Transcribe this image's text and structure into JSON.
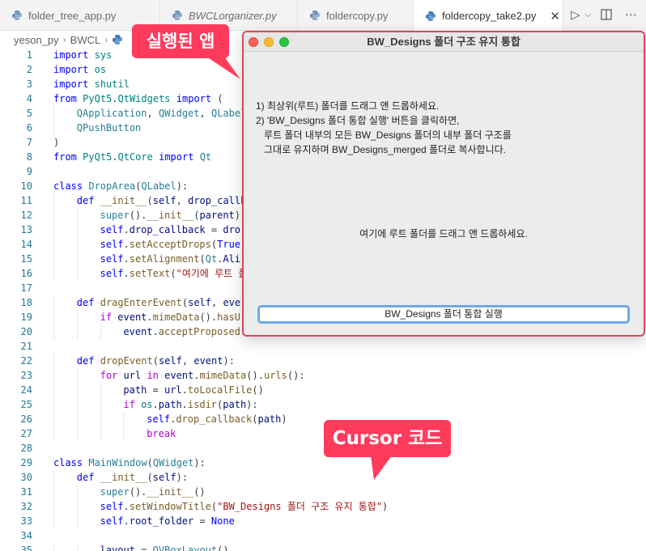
{
  "tabs": [
    {
      "label": "folder_tree_app.py",
      "style": "normal",
      "active": false
    },
    {
      "label": "BWCLorganizer.py",
      "style": "italic",
      "active": false
    },
    {
      "label": "foldercopy.py",
      "style": "normal",
      "active": false
    },
    {
      "label": "foldercopy_take2.py",
      "style": "normal",
      "active": true
    }
  ],
  "tab_close_glyph": "✕",
  "toolbar": {
    "run_icon": "▷",
    "run_menu_icon": "⌵",
    "split_icon": "split-editor-icon",
    "more_icon": "⋯"
  },
  "breadcrumb": {
    "items": [
      "yeson_py",
      "BWCL"
    ],
    "separator": "›"
  },
  "colors": {
    "callout": "#ff3b5c",
    "window_border": "#e0455a",
    "button_focus": "#6ea9e6",
    "line_number": "#237893"
  },
  "code": {
    "lines": [
      {
        "n": "1",
        "indent": 0,
        "tokens": [
          [
            "k",
            "import"
          ],
          [
            "t",
            " "
          ],
          [
            "m",
            "sys"
          ]
        ]
      },
      {
        "n": "2",
        "indent": 0,
        "tokens": [
          [
            "k",
            "import"
          ],
          [
            "t",
            " "
          ],
          [
            "m",
            "os"
          ]
        ]
      },
      {
        "n": "3",
        "indent": 0,
        "tokens": [
          [
            "k",
            "import"
          ],
          [
            "t",
            " "
          ],
          [
            "m",
            "shutil"
          ]
        ]
      },
      {
        "n": "4",
        "indent": 0,
        "tokens": [
          [
            "k",
            "from"
          ],
          [
            "t",
            " "
          ],
          [
            "m",
            "PyQt5"
          ],
          [
            "t",
            "."
          ],
          [
            "m",
            "QtWidgets"
          ],
          [
            "t",
            " "
          ],
          [
            "k",
            "import"
          ],
          [
            "t",
            " ("
          ]
        ]
      },
      {
        "n": "5",
        "indent": 1,
        "tokens": [
          [
            "c",
            "QApplication"
          ],
          [
            "t",
            ", "
          ],
          [
            "c",
            "QWidget"
          ],
          [
            "t",
            ", "
          ],
          [
            "c",
            "QLabel"
          ]
        ]
      },
      {
        "n": "6",
        "indent": 1,
        "tokens": [
          [
            "c",
            "QPushButton"
          ]
        ]
      },
      {
        "n": "7",
        "indent": 0,
        "tokens": [
          [
            "t",
            ")"
          ]
        ]
      },
      {
        "n": "8",
        "indent": 0,
        "tokens": [
          [
            "k",
            "from"
          ],
          [
            "t",
            " "
          ],
          [
            "m",
            "PyQt5"
          ],
          [
            "t",
            "."
          ],
          [
            "m",
            "QtCore"
          ],
          [
            "t",
            " "
          ],
          [
            "k",
            "import"
          ],
          [
            "t",
            " "
          ],
          [
            "c",
            "Qt"
          ]
        ]
      },
      {
        "n": "9",
        "indent": 0,
        "tokens": []
      },
      {
        "n": "10",
        "indent": 0,
        "tokens": [
          [
            "k",
            "class"
          ],
          [
            "t",
            " "
          ],
          [
            "c",
            "DropArea"
          ],
          [
            "t",
            "("
          ],
          [
            "c",
            "QLabel"
          ],
          [
            "t",
            "):"
          ]
        ]
      },
      {
        "n": "11",
        "indent": 1,
        "tokens": [
          [
            "k",
            "def"
          ],
          [
            "t",
            " "
          ],
          [
            "f",
            "__init__"
          ],
          [
            "t",
            "("
          ],
          [
            "v",
            "self"
          ],
          [
            "t",
            ", "
          ],
          [
            "v",
            "drop_callb"
          ]
        ]
      },
      {
        "n": "12",
        "indent": 2,
        "tokens": [
          [
            "c",
            "super"
          ],
          [
            "t",
            "()."
          ],
          [
            "f",
            "__init__"
          ],
          [
            "t",
            "("
          ],
          [
            "v",
            "parent"
          ],
          [
            "t",
            ")"
          ]
        ]
      },
      {
        "n": "13",
        "indent": 2,
        "tokens": [
          [
            "sf",
            "self"
          ],
          [
            "t",
            "."
          ],
          [
            "v",
            "drop_callback"
          ],
          [
            "t",
            " = "
          ],
          [
            "v",
            "dro"
          ]
        ]
      },
      {
        "n": "14",
        "indent": 2,
        "tokens": [
          [
            "sf",
            "self"
          ],
          [
            "t",
            "."
          ],
          [
            "f",
            "setAcceptDrops"
          ],
          [
            "t",
            "("
          ],
          [
            "kc",
            "True"
          ]
        ]
      },
      {
        "n": "15",
        "indent": 2,
        "tokens": [
          [
            "sf",
            "self"
          ],
          [
            "t",
            "."
          ],
          [
            "f",
            "setAlignment"
          ],
          [
            "t",
            "("
          ],
          [
            "c",
            "Qt"
          ],
          [
            "t",
            "."
          ],
          [
            "v",
            "Ali"
          ]
        ]
      },
      {
        "n": "16",
        "indent": 2,
        "tokens": [
          [
            "sf",
            "self"
          ],
          [
            "t",
            "."
          ],
          [
            "f",
            "setText"
          ],
          [
            "t",
            "("
          ],
          [
            "s",
            "\"여기에 루트 폴"
          ]
        ]
      },
      {
        "n": "17",
        "indent": 0,
        "tokens": []
      },
      {
        "n": "18",
        "indent": 1,
        "tokens": [
          [
            "k",
            "def"
          ],
          [
            "t",
            " "
          ],
          [
            "f",
            "dragEnterEvent"
          ],
          [
            "t",
            "("
          ],
          [
            "v",
            "self"
          ],
          [
            "t",
            ", "
          ],
          [
            "v",
            "eve"
          ]
        ]
      },
      {
        "n": "19",
        "indent": 2,
        "tokens": [
          [
            "ctl",
            "if"
          ],
          [
            "t",
            " "
          ],
          [
            "v",
            "event"
          ],
          [
            "t",
            "."
          ],
          [
            "f",
            "mimeData"
          ],
          [
            "t",
            "()."
          ],
          [
            "f",
            "hasU"
          ]
        ]
      },
      {
        "n": "20",
        "indent": 3,
        "tokens": [
          [
            "v",
            "event"
          ],
          [
            "t",
            "."
          ],
          [
            "f",
            "acceptProposed"
          ]
        ]
      },
      {
        "n": "21",
        "indent": 0,
        "tokens": []
      },
      {
        "n": "22",
        "indent": 1,
        "tokens": [
          [
            "k",
            "def"
          ],
          [
            "t",
            " "
          ],
          [
            "f",
            "dropEvent"
          ],
          [
            "t",
            "("
          ],
          [
            "v",
            "self"
          ],
          [
            "t",
            ", "
          ],
          [
            "v",
            "event"
          ],
          [
            "t",
            "):"
          ]
        ]
      },
      {
        "n": "23",
        "indent": 2,
        "tokens": [
          [
            "ctl",
            "for"
          ],
          [
            "t",
            " "
          ],
          [
            "v",
            "url"
          ],
          [
            "t",
            " "
          ],
          [
            "ctl",
            "in"
          ],
          [
            "t",
            " "
          ],
          [
            "v",
            "event"
          ],
          [
            "t",
            "."
          ],
          [
            "f",
            "mimeData"
          ],
          [
            "t",
            "()."
          ],
          [
            "f",
            "urls"
          ],
          [
            "t",
            "():"
          ]
        ]
      },
      {
        "n": "24",
        "indent": 3,
        "tokens": [
          [
            "v",
            "path"
          ],
          [
            "t",
            " = "
          ],
          [
            "v",
            "url"
          ],
          [
            "t",
            "."
          ],
          [
            "f",
            "toLocalFile"
          ],
          [
            "t",
            "()"
          ]
        ]
      },
      {
        "n": "25",
        "indent": 3,
        "tokens": [
          [
            "ctl",
            "if"
          ],
          [
            "t",
            " "
          ],
          [
            "m",
            "os"
          ],
          [
            "t",
            "."
          ],
          [
            "v",
            "path"
          ],
          [
            "t",
            "."
          ],
          [
            "f",
            "isdir"
          ],
          [
            "t",
            "("
          ],
          [
            "v",
            "path"
          ],
          [
            "t",
            "):"
          ]
        ]
      },
      {
        "n": "26",
        "indent": 4,
        "tokens": [
          [
            "sf",
            "self"
          ],
          [
            "t",
            "."
          ],
          [
            "f",
            "drop_callback"
          ],
          [
            "t",
            "("
          ],
          [
            "v",
            "path"
          ],
          [
            "t",
            ")"
          ]
        ]
      },
      {
        "n": "27",
        "indent": 4,
        "tokens": [
          [
            "ctl",
            "break"
          ]
        ]
      },
      {
        "n": "28",
        "indent": 0,
        "tokens": []
      },
      {
        "n": "29",
        "indent": 0,
        "tokens": [
          [
            "k",
            "class"
          ],
          [
            "t",
            " "
          ],
          [
            "c",
            "MainWindow"
          ],
          [
            "t",
            "("
          ],
          [
            "c",
            "QWidget"
          ],
          [
            "t",
            "):"
          ]
        ]
      },
      {
        "n": "30",
        "indent": 1,
        "tokens": [
          [
            "k",
            "def"
          ],
          [
            "t",
            " "
          ],
          [
            "f",
            "__init__"
          ],
          [
            "t",
            "("
          ],
          [
            "v",
            "self"
          ],
          [
            "t",
            "):"
          ]
        ]
      },
      {
        "n": "31",
        "indent": 2,
        "tokens": [
          [
            "c",
            "super"
          ],
          [
            "t",
            "()."
          ],
          [
            "f",
            "__init__"
          ],
          [
            "t",
            "()"
          ]
        ]
      },
      {
        "n": "32",
        "indent": 2,
        "tokens": [
          [
            "sf",
            "self"
          ],
          [
            "t",
            "."
          ],
          [
            "f",
            "setWindowTitle"
          ],
          [
            "t",
            "("
          ],
          [
            "s",
            "\"BW_Designs 폴더 구조 유지 통합\""
          ],
          [
            "t",
            ")"
          ]
        ]
      },
      {
        "n": "33",
        "indent": 2,
        "tokens": [
          [
            "sf",
            "self"
          ],
          [
            "t",
            "."
          ],
          [
            "v",
            "root_folder"
          ],
          [
            "t",
            " = "
          ],
          [
            "kc",
            "None"
          ]
        ]
      },
      {
        "n": "34",
        "indent": 0,
        "tokens": []
      },
      {
        "n": "35",
        "indent": 2,
        "tokens": [
          [
            "v",
            "layout"
          ],
          [
            "t",
            " = "
          ],
          [
            "c",
            "QVBoxLayout"
          ],
          [
            "t",
            "()"
          ]
        ]
      }
    ]
  },
  "app_window": {
    "title": "BW_Designs 폴더 구조 유지 통합",
    "instructions": [
      "1) 최상위(루트) 폴더를 드래그 앤 드롭하세요.",
      "2) 'BW_Designs 폴더 통합 실행' 버튼을 클릭하면,",
      "   루트 폴더 내부의 모든 BW_Designs 폴더의 내부 폴더 구조를",
      "   그대로 유지하며 BW_Designs_merged 폴더로 복사합니다."
    ],
    "drop_area_text": "여기에 루트 폴더를 드래그 앤 드롭하세요.",
    "merge_button_label": "BW_Designs 폴더 통합 실행"
  },
  "callouts": {
    "running_app": "실행된 앱",
    "cursor_code": "Cursor 코드"
  }
}
